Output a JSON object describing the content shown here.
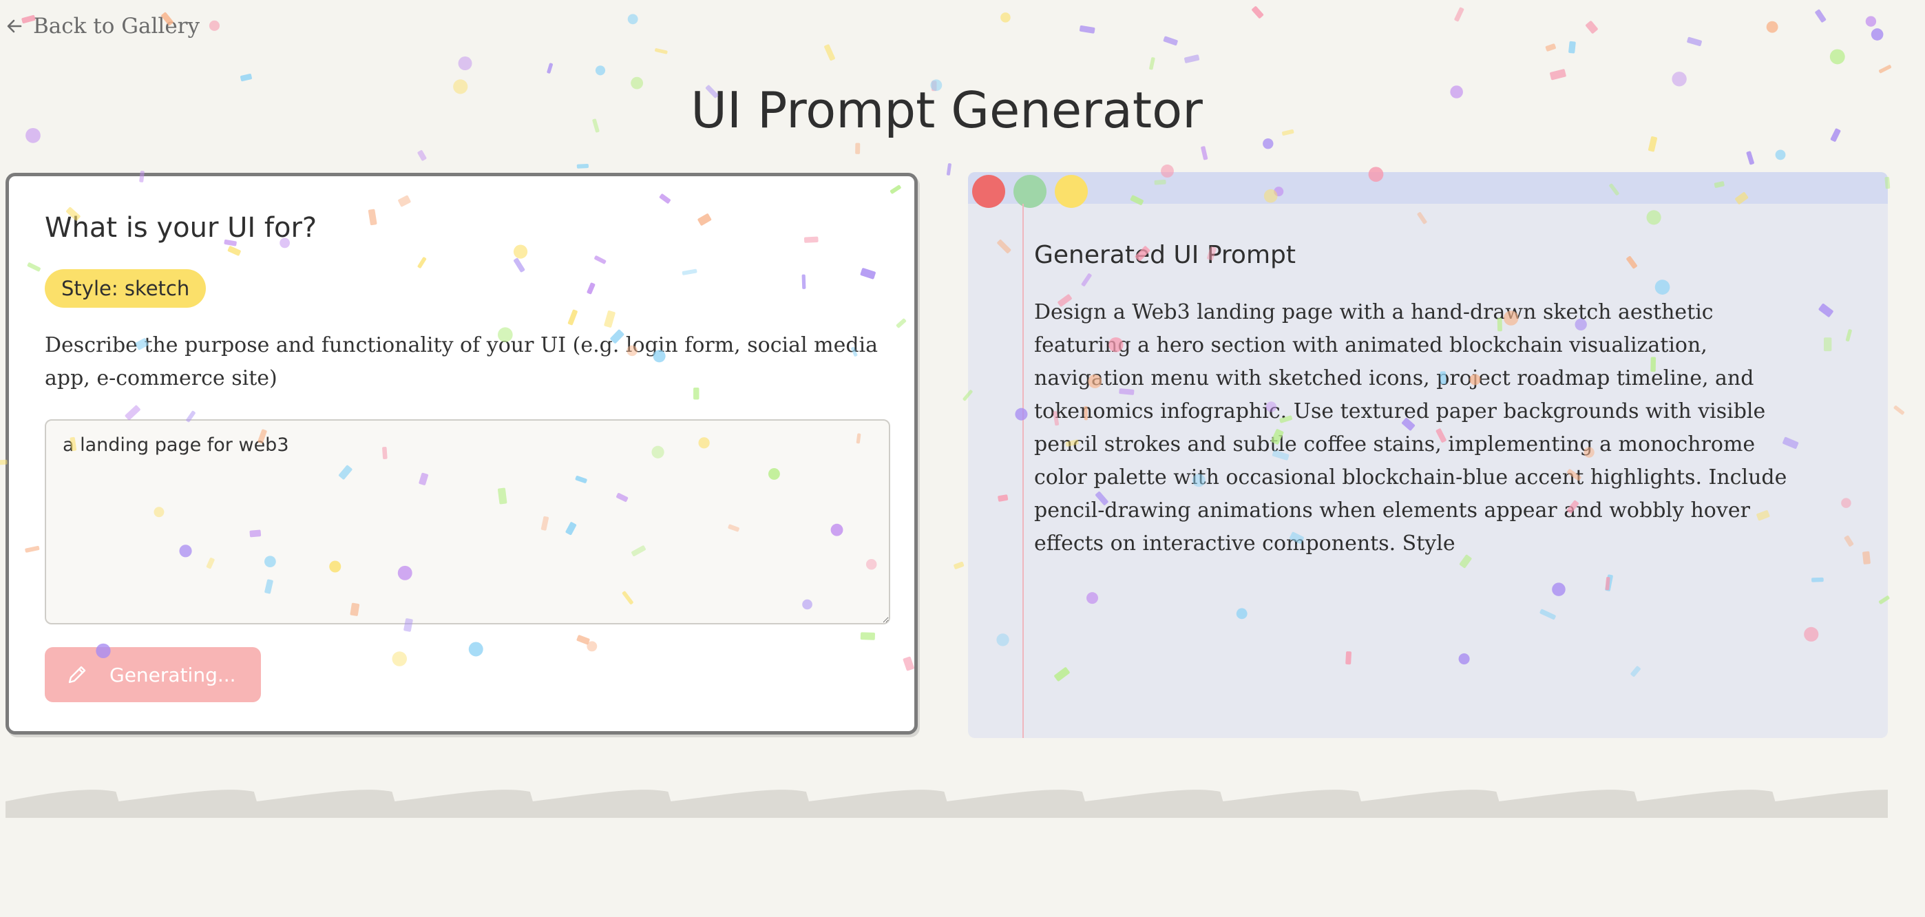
{
  "nav": {
    "back_label": "Back to Gallery",
    "back_icon": "arrow-left-icon"
  },
  "page": {
    "title": "UI Prompt Generator"
  },
  "input_panel": {
    "heading": "What is your UI for?",
    "style_badge": "Style: sketch",
    "description": "Describe the purpose and functionality of your UI (e.g. login form, social media app, e-commerce site)",
    "textarea_value": "a landing page for web3",
    "generate_button": {
      "label": "Generating...",
      "icon": "pencil-icon",
      "background": "#f8b5b5"
    }
  },
  "output_panel": {
    "heading": "Generated UI Prompt",
    "text": "Design a Web3 landing page with a hand-drawn sketch aesthetic featuring a hero section with animated blockchain visualization, navigation menu with sketched icons, project roadmap timeline, and tokenomics infographic. Use textured paper backgrounds with visible pencil strokes and subtle coffee stains, implementing a monochrome color palette with occasional blockchain-blue accent highlights. Include pencil-drawing animations when elements appear and wobbly hover effects on interactive components. Style",
    "window_dots": [
      "#ee6b6b",
      "#9fd6a8",
      "#fbe06a"
    ]
  },
  "colors": {
    "background": "#f5f4ef",
    "badge": "#fbe06a",
    "output_background": "#e6e8f0",
    "output_bar": "#d4daf1"
  }
}
